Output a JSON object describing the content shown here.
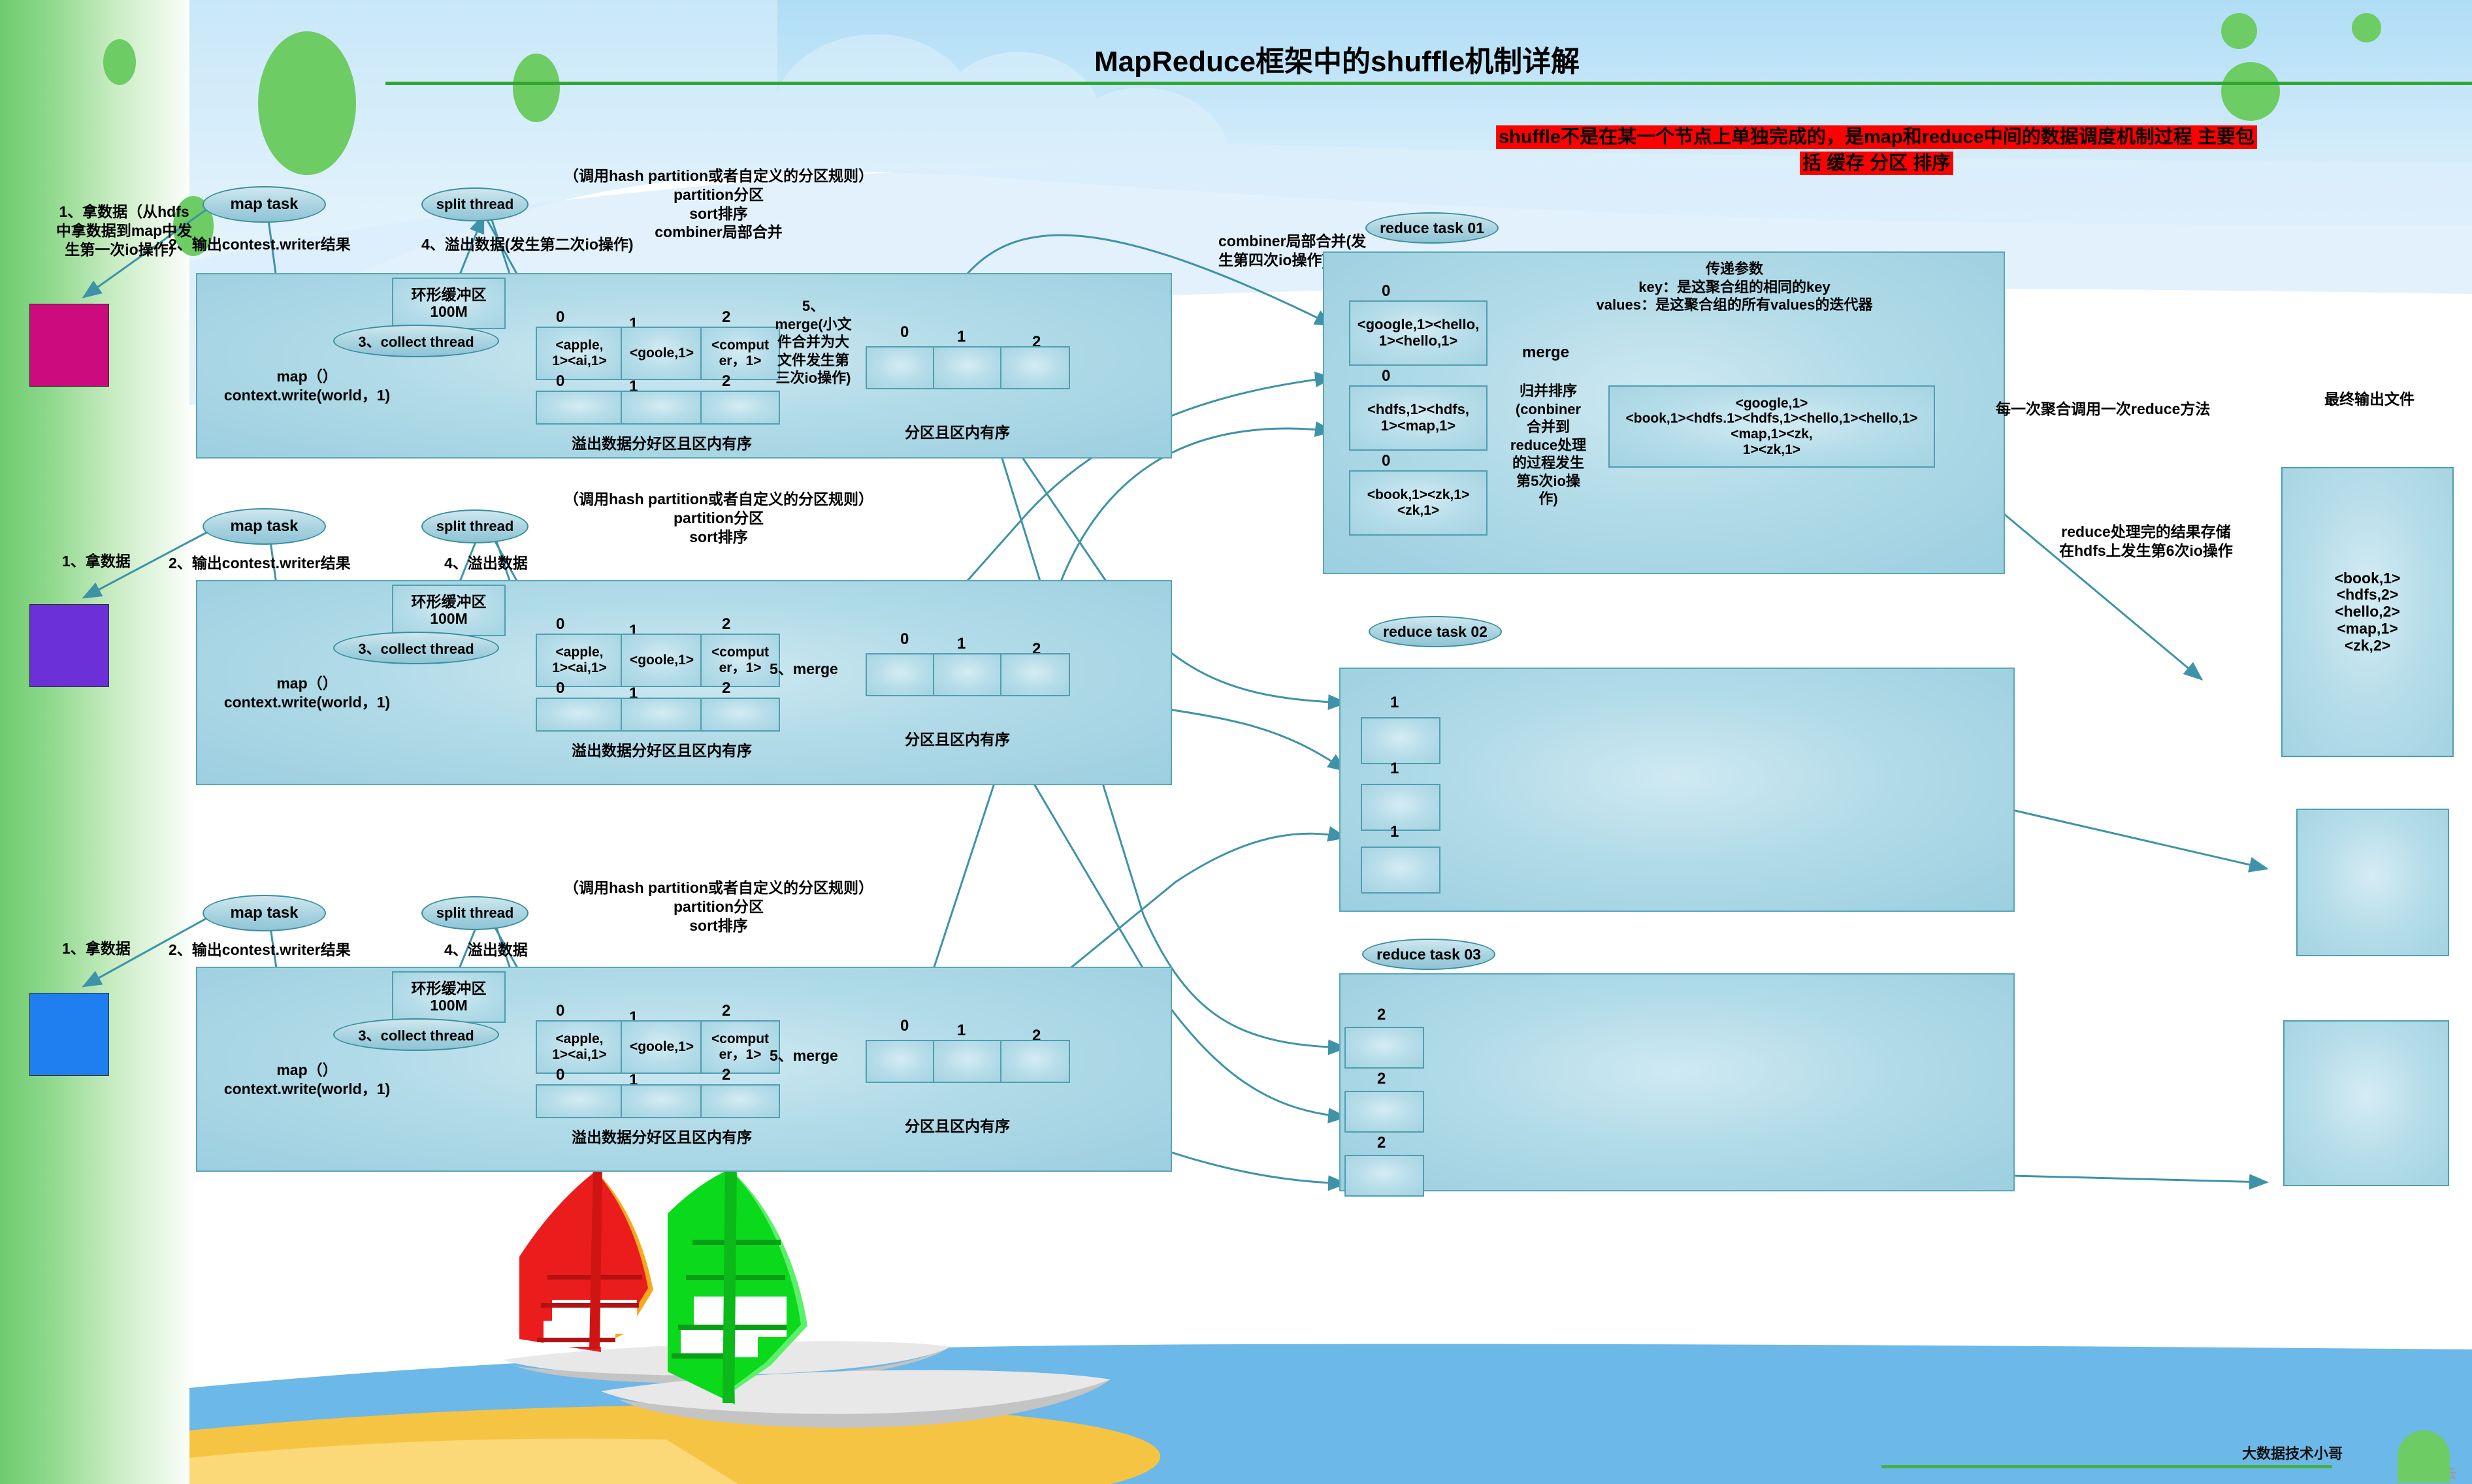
{
  "title": "MapReduce框架中的shuffle机制详解",
  "banner": {
    "line1": "shuffle不是在某一个节点上单独完成的，是map和reduce中间的数据调度机制过程 主要包",
    "line2": "括 缓存 分区 排序"
  },
  "map_stages": [
    {
      "step1": "1、拿数据（从hdfs\n中拿数据到map中发\n生第一次io操作）",
      "map_task": "map task",
      "step2": "2、输出contest.writer结果",
      "split_thread": "split thread",
      "step4": "4、溢出数据(发生第二次io操作)",
      "note": "（调用hash partition或者自定义的分区规则）\npartition分区\nsort排序\ncombiner局部合并",
      "buffer": "环形缓冲区\n100M",
      "collect": "3、collect thread",
      "map_code": "map（）\ncontext.write(world，1)",
      "partitions_top": [
        "<apple,\n1><ai,1>",
        "<goole,1>",
        "<comput\ner，1>"
      ],
      "partitions_bottom": [
        "",
        "",
        ""
      ],
      "idx_labels": [
        "0",
        "1",
        "2"
      ],
      "spill_caption": "溢出数据分好区且区内有序",
      "merge_note": "5、\nmerge(小文\n件合并为大\n文件发生第\n三次io操作)",
      "merged": [
        "",
        "",
        ""
      ],
      "merged_caption": "分区且区内有序"
    },
    {
      "step1": "1、拿数据",
      "map_task": "map task",
      "step2": "2、输出contest.writer结果",
      "split_thread": "split thread",
      "step4": "4、溢出数据",
      "note": "（调用hash partition或者自定义的分区规则）\npartition分区\nsort排序",
      "buffer": "环形缓冲区\n100M",
      "collect": "3、collect thread",
      "map_code": "map（）\ncontext.write(world，1)",
      "partitions_top": [
        "<apple,\n1><ai,1>",
        "<goole,1>",
        "<comput\ner，1>"
      ],
      "partitions_bottom": [
        "",
        "",
        ""
      ],
      "idx_labels": [
        "0",
        "1",
        "2"
      ],
      "spill_caption": "溢出数据分好区且区内有序",
      "merge_note": "5、merge",
      "merged": [
        "",
        "",
        ""
      ],
      "merged_caption": "分区且区内有序"
    },
    {
      "step1": "1、拿数据",
      "map_task": "map task",
      "step2": "2、输出contest.writer结果",
      "split_thread": "split thread",
      "step4": "4、溢出数据",
      "note": "（调用hash partition或者自定义的分区规则）\npartition分区\nsort排序",
      "buffer": "环形缓冲区\n100M",
      "collect": "3、collect thread",
      "map_code": "map（）\ncontext.write(world，1)",
      "partitions_top": [
        "<apple,\n1><ai,1>",
        "<goole,1>",
        "<comput\ner，1>"
      ],
      "partitions_bottom": [
        "",
        "",
        ""
      ],
      "idx_labels": [
        "0",
        "1",
        "2"
      ],
      "spill_caption": "溢出数据分好区且区内有序",
      "merge_note": "5、merge",
      "merged": [
        "",
        "",
        ""
      ],
      "merged_caption": "分区且区内有序"
    }
  ],
  "combiner_note": "combiner局部合并(发\n生第四次io操作)",
  "reduce_tasks": [
    {
      "label": "reduce task 01",
      "inputs": [
        {
          "idx": "0",
          "text": "<google,1><hello,\n1><hello,1>"
        },
        {
          "idx": "0",
          "text": "<hdfs,1><hdfs,\n1><map,1>"
        },
        {
          "idx": "0",
          "text": "<book,1><zk,1><zk,1>"
        }
      ],
      "merge_label": "merge",
      "merge_note": "归并排序\n(conbiner\n合并到\nreduce处理\n的过程发生\n第5次io操\n作)",
      "merged_text": "<google,1>\n<book,1><hdfs.1><hdfs,1><hello,1><hello,1><map,1><zk,\n1><zk,1>",
      "params_note": "传递参数\nkey：是这聚合组的相同的key\nvalues：是这聚合组的所有values的迭代器",
      "call_note": "每一次聚合调用一次reduce方法"
    },
    {
      "label": "reduce task 02",
      "inputs": [
        {
          "idx": "1",
          "text": ""
        },
        {
          "idx": "1",
          "text": ""
        },
        {
          "idx": "1",
          "text": ""
        }
      ]
    },
    {
      "label": "reduce task 03",
      "inputs": [
        {
          "idx": "2",
          "text": ""
        },
        {
          "idx": "2",
          "text": ""
        },
        {
          "idx": "2",
          "text": ""
        }
      ]
    }
  ],
  "output": {
    "header": "最终输出文件",
    "store_note": "reduce处理完的结果存储\n在hdfs上发生第6次io操作",
    "lines": [
      "<book,1>",
      "<hdfs,2>",
      "<hello,2>",
      "<map,1>",
      "<zk,2>"
    ],
    "extra_boxes": [
      "",
      ""
    ]
  },
  "watermark": {
    "author": "大数据技术小哥",
    "logo": "亿速云"
  },
  "colors": {
    "banner_red": "#ff0000",
    "panel_border": "#5aa7b8",
    "accent_green": "#33a532",
    "source_1": "#cc0b7f",
    "source_2": "#6b30d8",
    "source_3": "#1f7ff0"
  }
}
